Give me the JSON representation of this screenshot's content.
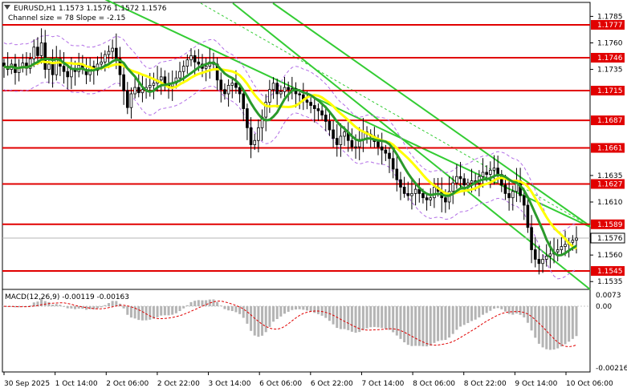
{
  "header": {
    "symbol_line": "EURUSD,H1  1.1573 1.1576 1.1572 1.1576",
    "channel_line": "Channel size = 78 Slope = -2.15"
  },
  "macd": {
    "label": "MACD(12,26,9) -0.00119 -0.00163",
    "scale": [
      "0.0073",
      "0.00",
      "-0.00216"
    ]
  },
  "colors": {
    "level": "#e10000",
    "channel": "#33cc33",
    "ma_fast": "#ffff00",
    "ma_slow": "#2a9a2a",
    "candle": "#000000",
    "macd_hist": "#b4b4b4",
    "macd_signal": "#e10000",
    "envelope": "#b26ee6"
  },
  "chart_data": {
    "type": "candlestick",
    "symbol": "EURUSD",
    "timeframe": "H1",
    "price_axis_ticks": [
      "1.1785",
      "1.1760",
      "1.1735",
      "1.1710",
      "1.1685",
      "1.1660",
      "1.1635",
      "1.1610",
      "1.1585",
      "1.1560",
      "1.1535"
    ],
    "levels": [
      {
        "price": "1.1777",
        "value": 1.1777
      },
      {
        "price": "1.1746",
        "value": 1.1746
      },
      {
        "price": "1.1715",
        "value": 1.1715
      },
      {
        "price": "1.1687",
        "value": 1.1687
      },
      {
        "price": "1.1661",
        "value": 1.1661
      },
      {
        "price": "1.1627",
        "value": 1.1627
      },
      {
        "price": "1.1589",
        "value": 1.1589
      },
      {
        "price": "1.1545",
        "value": 1.1545
      }
    ],
    "current_price": {
      "label": "1.1576",
      "value": 1.1576
    },
    "x_labels": [
      "30 Sep 2025",
      "1 Oct 14:00",
      "2 Oct 06:00",
      "2 Oct 22:00",
      "3 Oct 14:00",
      "6 Oct 06:00",
      "6 Oct 22:00",
      "7 Oct 14:00",
      "8 Oct 06:00",
      "8 Oct 22:00",
      "9 Oct 14:00",
      "10 Oct 06:00"
    ],
    "closes": [
      1.1738,
      1.1735,
      1.174,
      1.1732,
      1.1737,
      1.1741,
      1.1736,
      1.1745,
      1.1756,
      1.1748,
      1.176,
      1.1735,
      1.174,
      1.173,
      1.1745,
      1.1738,
      1.1733,
      1.1728,
      1.1736,
      1.1733,
      1.1739,
      1.1735,
      1.173,
      1.1738,
      1.1734,
      1.174,
      1.1742,
      1.1749,
      1.1752,
      1.1755,
      1.1745,
      1.173,
      1.1715,
      1.1699,
      1.1712,
      1.1718,
      1.1713,
      1.1716,
      1.1718,
      1.172,
      1.1722,
      1.1725,
      1.1728,
      1.1721,
      1.1719,
      1.1722,
      1.1727,
      1.1733,
      1.1738,
      1.1744,
      1.1748,
      1.1742,
      1.174,
      1.1736,
      1.1738,
      1.1742,
      1.174,
      1.1725,
      1.1716,
      1.1712,
      1.172,
      1.1722,
      1.1718,
      1.1712,
      1.1698,
      1.168,
      1.1664,
      1.1668,
      1.168,
      1.169,
      1.1704,
      1.1716,
      1.1722,
      1.1712,
      1.1714,
      1.1718,
      1.1716,
      1.1717,
      1.1712,
      1.1711,
      1.1706,
      1.1704,
      1.1701,
      1.1698,
      1.1696,
      1.1692,
      1.1686,
      1.1678,
      1.167,
      1.1664,
      1.1672,
      1.1676,
      1.1668,
      1.1662,
      1.1662,
      1.1669,
      1.1676,
      1.1674,
      1.1672,
      1.1667,
      1.1662,
      1.1659,
      1.1656,
      1.1651,
      1.1641,
      1.1631,
      1.1624,
      1.1618,
      1.1616,
      1.1618,
      1.1622,
      1.1618,
      1.1614,
      1.1612,
      1.1614,
      1.1624,
      1.162,
      1.1614,
      1.161,
      1.162,
      1.1628,
      1.1634,
      1.1632,
      1.1626,
      1.1628,
      1.163,
      1.1628,
      1.1634,
      1.1638,
      1.1636,
      1.164,
      1.1642,
      1.1636,
      1.1626,
      1.1618,
      1.1614,
      1.162,
      1.163,
      1.1616,
      1.1607,
      1.1586,
      1.1565,
      1.1556,
      1.1552,
      1.1556,
      1.1559,
      1.1561,
      1.1563,
      1.1565,
      1.1568,
      1.157,
      1.1572,
      1.1574,
      1.1576
    ],
    "ma_fast": {
      "start": 1.1732,
      "end": 1.1605
    },
    "ma_slow": {
      "start": 1.1736,
      "end": 1.1596
    }
  }
}
